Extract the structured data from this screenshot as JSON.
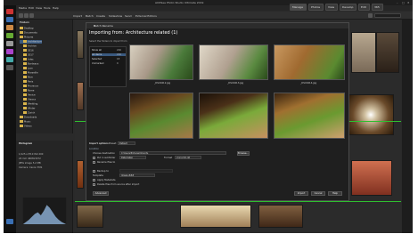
{
  "window": {
    "title": "ACDSee Photo Studio Ultimate 2019"
  },
  "menu": {
    "items": [
      "Media",
      "Edit",
      "View",
      "Tools",
      "Help"
    ]
  },
  "modes": [
    "Manage",
    "Photos",
    "View",
    "Develop",
    "Edit",
    "365"
  ],
  "toolbar": {
    "items": [
      "Import",
      "Batch",
      "Create",
      "Slideshow",
      "Send",
      "External Editors"
    ]
  },
  "folders": {
    "header": "Folders",
    "rows": [
      "Desktop",
      "Documents",
      "Pictures",
      "Architecture",
      "Archive",
      "2016",
      "2017",
      "Arles",
      "Bordeaux",
      "Lyon",
      "Marseille",
      "Nice",
      "Paris",
      "Provence",
      "Rome",
      "Venice",
      "Vienna",
      "Wedding",
      "Winter",
      "Zurich",
      "Downloads",
      "Music",
      "Videos"
    ]
  },
  "info": {
    "header": "Histogram",
    "lines": [
      "1/125 s   f/8.0   ISO 200",
      "24 mm   4608x3072",
      "JPEG image  5.2 MB",
      "Camera: Canon EOS"
    ]
  },
  "dialog": {
    "title": "Batch Rename",
    "header": "Importing from: Architecture related (1)",
    "subtitle": "Select the folders to import from",
    "list": [
      {
        "name": "Show all",
        "count": "216"
      },
      {
        "name": "All items",
        "count": "216"
      },
      {
        "name": "Selected",
        "count": "18"
      },
      {
        "name": "Unmarked",
        "count": "0"
      }
    ],
    "captions": [
      "_DSC0412.jpg",
      "_DSC0413.jpg",
      "_DSC0414.jpg",
      "_DSC0415.jpg",
      "_DSC0416.jpg",
      "_DSC0417.jpg"
    ],
    "settings": {
      "header": "Import options",
      "preset_label": "Preset:",
      "preset_value": "Default",
      "location_label": "Location",
      "dest_label": "Choose destination",
      "dest_value": "C:\\Users\\Pictures\\Imports",
      "browse": "Browse...",
      "subfolder_label": "Put in subfolder",
      "subfolder_value": "Date taken",
      "format_label": "Format",
      "format_value": "yyyy-mm-dd",
      "rename_label": "Rename files to",
      "template_label": "Template",
      "template_value": "Image ###",
      "backup_label": "Backup to",
      "apply_label": "Apply Metadata",
      "delete_label": "Delete files from source after import",
      "import_btn": "Import",
      "cancel_btn": "Cancel",
      "help_btn": "Help",
      "advanced_btn": "Advanced"
    }
  },
  "colors": {
    "accent_green": "#2fbf2f",
    "folder": "#d8b34a",
    "selection": "#3a5a80"
  }
}
